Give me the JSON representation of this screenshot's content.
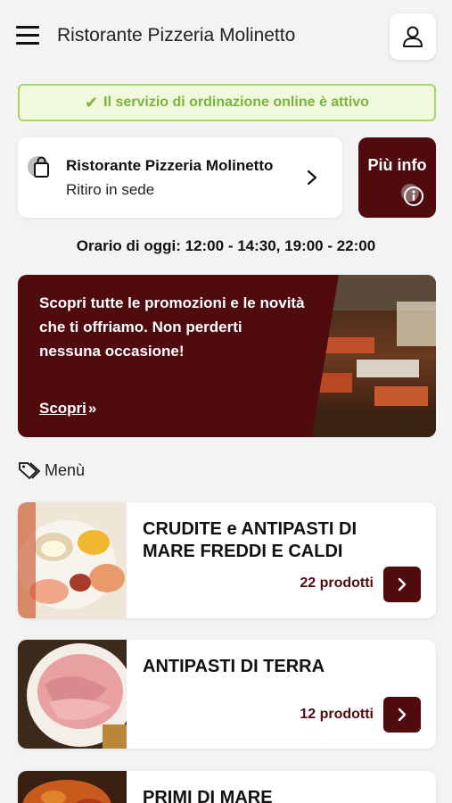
{
  "header": {
    "title": "Ristorante Pizzeria Molinetto",
    "menu_icon": "hamburger-icon",
    "account_icon": "user-icon"
  },
  "status": {
    "text": "Il servizio di ordinazione online è attivo",
    "icon": "check-icon",
    "color": "#7bb341"
  },
  "store": {
    "name": "Ristorante Pizzeria Molinetto",
    "mode": "Ritiro in sede",
    "icon": "shopping-bag-icon"
  },
  "info_button": {
    "label": "Più info",
    "icon": "info-icon"
  },
  "hours": {
    "text": "Orario di oggi: 12:00 - 14:30, 19:00 - 22:00"
  },
  "promo": {
    "text": "Scopri tutte le promozioni e le novità che ti offriamo. Non perderti nessuna occasione!",
    "link_label": "Scopri",
    "link_icon": "double-chevron-right-icon"
  },
  "menu": {
    "label": "Menù",
    "icon": "tags-icon",
    "categories": [
      {
        "title": "CRUDITE e ANTIPASTI DI MARE FREDDI E CALDI",
        "count": "22 prodotti"
      },
      {
        "title": "ANTIPASTI DI TERRA",
        "count": "12 prodotti"
      },
      {
        "title": "PRIMI DI MARE",
        "count": ""
      }
    ]
  },
  "colors": {
    "brand": "#4f0b0e",
    "success_bg": "#f1f9dc",
    "success_border": "#a8d56a"
  }
}
